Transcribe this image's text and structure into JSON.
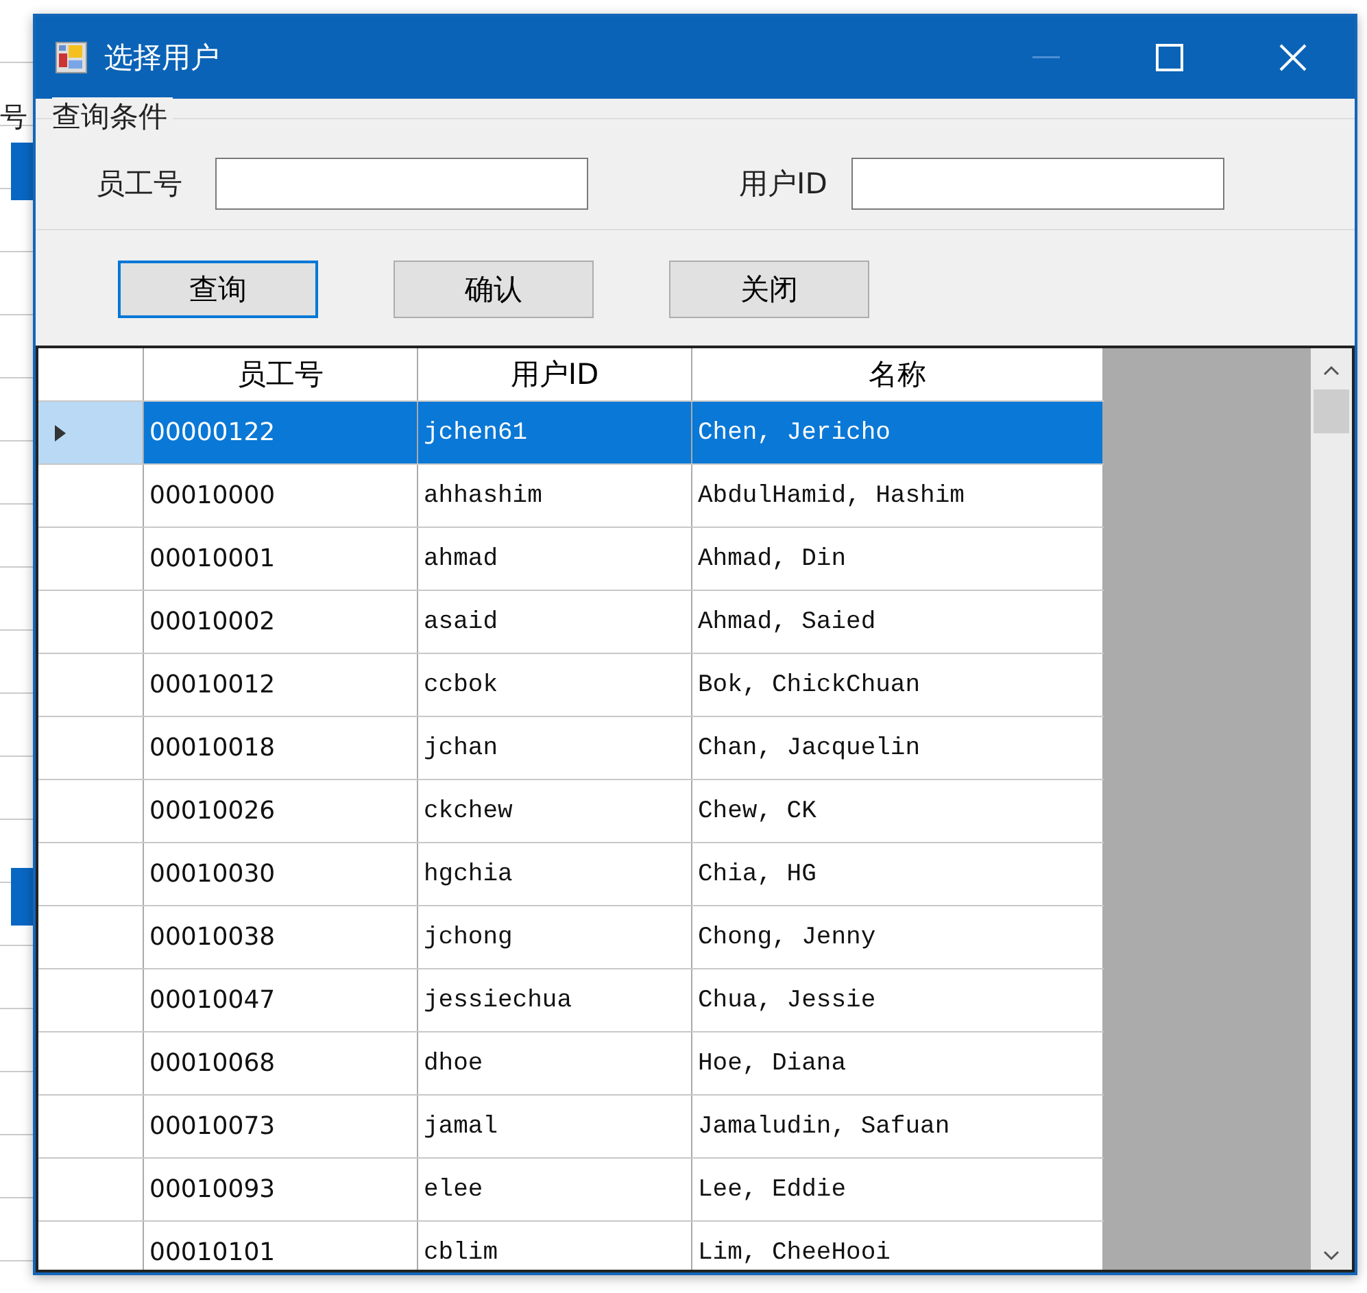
{
  "background": {
    "label": "号"
  },
  "window": {
    "title": "选择用户"
  },
  "query_group": {
    "title": "查询条件",
    "fields": [
      {
        "label": "员工号"
      },
      {
        "label": "用户ID"
      }
    ]
  },
  "buttons": [
    {
      "label": "查询",
      "selected": true
    },
    {
      "label": "确认",
      "selected": false
    },
    {
      "label": "关闭",
      "selected": false
    }
  ],
  "table": {
    "columns": [
      "员工号",
      "用户ID",
      "名称"
    ],
    "rows": [
      {
        "cells": [
          "00000122",
          "jchen61",
          "Chen, Jericho"
        ],
        "selected": true
      },
      {
        "cells": [
          "00010000",
          "ahhashim",
          "AbdulHamid, Hashim"
        ],
        "selected": false
      },
      {
        "cells": [
          "00010001",
          "ahmad",
          "Ahmad, Din"
        ],
        "selected": false
      },
      {
        "cells": [
          "00010002",
          "asaid",
          "Ahmad, Saied"
        ],
        "selected": false
      },
      {
        "cells": [
          "00010012",
          "ccbok",
          "Bok, ChickChuan"
        ],
        "selected": false
      },
      {
        "cells": [
          "00010018",
          "jchan",
          "Chan, Jacquelin"
        ],
        "selected": false
      },
      {
        "cells": [
          "00010026",
          "ckchew",
          "Chew, CK"
        ],
        "selected": false
      },
      {
        "cells": [
          "00010030",
          "hgchia",
          "Chia, HG"
        ],
        "selected": false
      },
      {
        "cells": [
          "00010038",
          "jchong",
          "Chong, Jenny"
        ],
        "selected": false
      },
      {
        "cells": [
          "00010047",
          "jessiechua",
          "Chua, Jessie"
        ],
        "selected": false
      },
      {
        "cells": [
          "00010068",
          "dhoe",
          "Hoe, Diana"
        ],
        "selected": false
      },
      {
        "cells": [
          "00010073",
          "jamal",
          "Jamaludin, Safuan"
        ],
        "selected": false
      },
      {
        "cells": [
          "00010093",
          "elee",
          "Lee, Eddie"
        ],
        "selected": false
      },
      {
        "cells": [
          "00010101",
          "cblim",
          "Lim, CheeHooi"
        ],
        "selected": false
      }
    ]
  }
}
